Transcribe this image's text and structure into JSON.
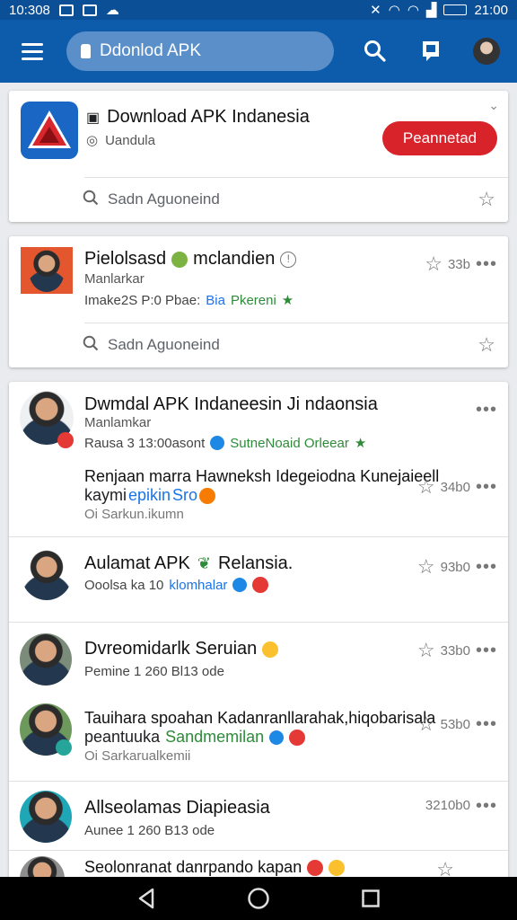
{
  "status": {
    "time_left": "10:308",
    "time_right": "21:00"
  },
  "appbar": {
    "search_text": "Ddonlod APK"
  },
  "featured": {
    "title": "Download APK Indanesia",
    "developer": "Uandula",
    "install_label": "Peannetad",
    "search_label": "Sadn Aguoneind"
  },
  "card2": {
    "title": "Pielolsasd",
    "title_suffix": "mclandien",
    "sub": "Manlarkar",
    "meta": "Imake2S P:0 Pbae:",
    "meta_blue": "Bia",
    "meta_green": "Pkereni",
    "count": "33b",
    "search_label": "Sadn Aguoneind"
  },
  "feed": [
    {
      "title": "Dwmdal APK Indaneesin Ji ndaonsia",
      "sub": "Manlamkar",
      "meta": "Rausa 3 13:00asont",
      "meta_green": "SutneNoaid Orleear",
      "body1": "Renjaan marra Hawneksh Idegeiodna Kunejaieell",
      "body2a": "kaymi",
      "body2b": "epikin",
      "body2c": "Sro",
      "foot": "Oi Sarkun.ikumn",
      "count": "34b0"
    },
    {
      "title": "Aulamat APK",
      "title_b": "Relansia.",
      "meta": "Ooolsa ka 10",
      "meta_blue": "klomhalar",
      "count": "93b0"
    },
    {
      "title": "Dvreomidarlk Seruian",
      "meta": "Pemine 1 260 Bl13 ode",
      "count": "33b0"
    },
    {
      "title": "Tauihara spoahan Kadanranllarahak,hiqobarisala",
      "body": "peantuuka",
      "body_green": "Sandmemilan",
      "foot": "Oi Sarkarualkemii",
      "count": "53b0"
    },
    {
      "title": "Allseolamas Diapieasia",
      "meta": "Aunee 1 260 B13 ode",
      "count": "3210b0"
    },
    {
      "title": "Seolonranat danrpando kapan"
    }
  ],
  "colors": {
    "appbar": "#0d5cab",
    "statusbar": "#0b4f97",
    "install": "#d9232b",
    "accent_green": "#2e8b3a",
    "accent_blue": "#1a73e8"
  }
}
